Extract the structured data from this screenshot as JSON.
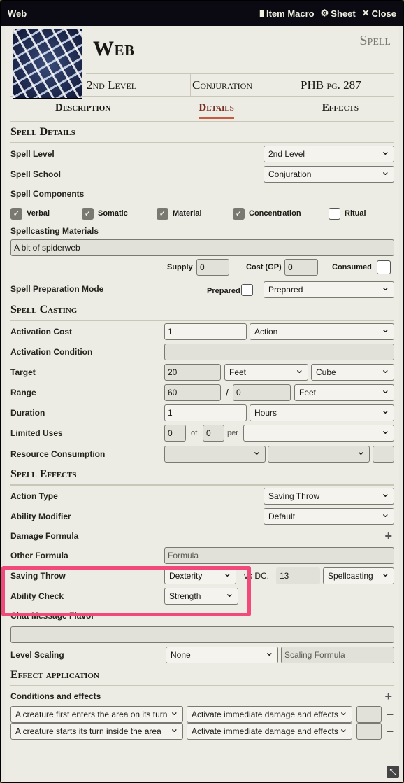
{
  "window": {
    "title": "Web",
    "buttons": [
      {
        "icon": "book-icon",
        "label": "Item Macro"
      },
      {
        "icon": "gear-icon",
        "label": "Sheet"
      },
      {
        "icon": "close-icon",
        "label": "Close"
      }
    ]
  },
  "header": {
    "name": "Web",
    "type": "Spell",
    "level": "2nd Level",
    "school": "Conjuration",
    "source": "PHB pg. 287"
  },
  "tabs": [
    "Description",
    "Details",
    "Effects"
  ],
  "active_tab": "Details",
  "spell_details": {
    "title": "Spell Details",
    "level_label": "Spell Level",
    "level_value": "2nd Level",
    "school_label": "Spell School",
    "school_value": "Conjuration",
    "components_label": "Spell Components",
    "components": [
      {
        "label": "Verbal",
        "checked": true
      },
      {
        "label": "Somatic",
        "checked": true
      },
      {
        "label": "Material",
        "checked": true
      },
      {
        "label": "Concentration",
        "checked": true
      },
      {
        "label": "Ritual",
        "checked": false
      }
    ],
    "materials_label": "Spellcasting Materials",
    "materials_value": "A bit of spiderweb",
    "supply_label": "Supply",
    "supply_value": "0",
    "cost_label": "Cost (GP)",
    "cost_value": "0",
    "consumed_label": "Consumed",
    "prep_label": "Spell Preparation Mode",
    "prepared_label": "Prepared",
    "prep_value": "Prepared"
  },
  "spell_casting": {
    "title": "Spell Casting",
    "activation_cost_label": "Activation Cost",
    "activation_cost_value": "1",
    "activation_type": "Action",
    "activation_condition_label": "Activation Condition",
    "target_label": "Target",
    "target_value": "20",
    "target_units": "Feet",
    "target_type": "Cube",
    "range_label": "Range",
    "range_value": "60",
    "range_sep": "/",
    "range_long": "0",
    "range_units": "Feet",
    "duration_label": "Duration",
    "duration_value": "1",
    "duration_units": "Hours",
    "limited_uses_label": "Limited Uses",
    "uses_value": "0",
    "uses_of": "of",
    "uses_max": "0",
    "uses_per": "per",
    "resource_label": "Resource Consumption"
  },
  "spell_effects": {
    "title": "Spell Effects",
    "action_type_label": "Action Type",
    "action_type_value": "Saving Throw",
    "ability_mod_label": "Ability Modifier",
    "ability_mod_value": "Default",
    "damage_label": "Damage Formula",
    "other_label": "Other Formula",
    "other_placeholder": "Formula",
    "save_label": "Saving Throw",
    "save_value": "Dexterity",
    "vs_dc": "vs DC.",
    "dc_value": "13",
    "dc_type": "Spellcasting",
    "ability_check_label": "Ability Check",
    "ability_check_value": "Strength",
    "chat_flavor_label": "Chat Message Flavor",
    "level_scaling_label": "Level Scaling",
    "level_scaling_value": "None",
    "scaling_placeholder": "Scaling Formula"
  },
  "effect_application": {
    "title": "Effect application",
    "conditions_label": "Conditions and effects",
    "rows": [
      {
        "trigger": "A creature first enters the area on its turn",
        "action": "Activate immediate damage and effects"
      },
      {
        "trigger": "A creature starts its turn inside the area",
        "action": "Activate immediate damage and effects"
      }
    ]
  },
  "colors": {
    "accent": "#782e22",
    "highlight": "#f0497a",
    "titlebar": "#0b0a13"
  }
}
